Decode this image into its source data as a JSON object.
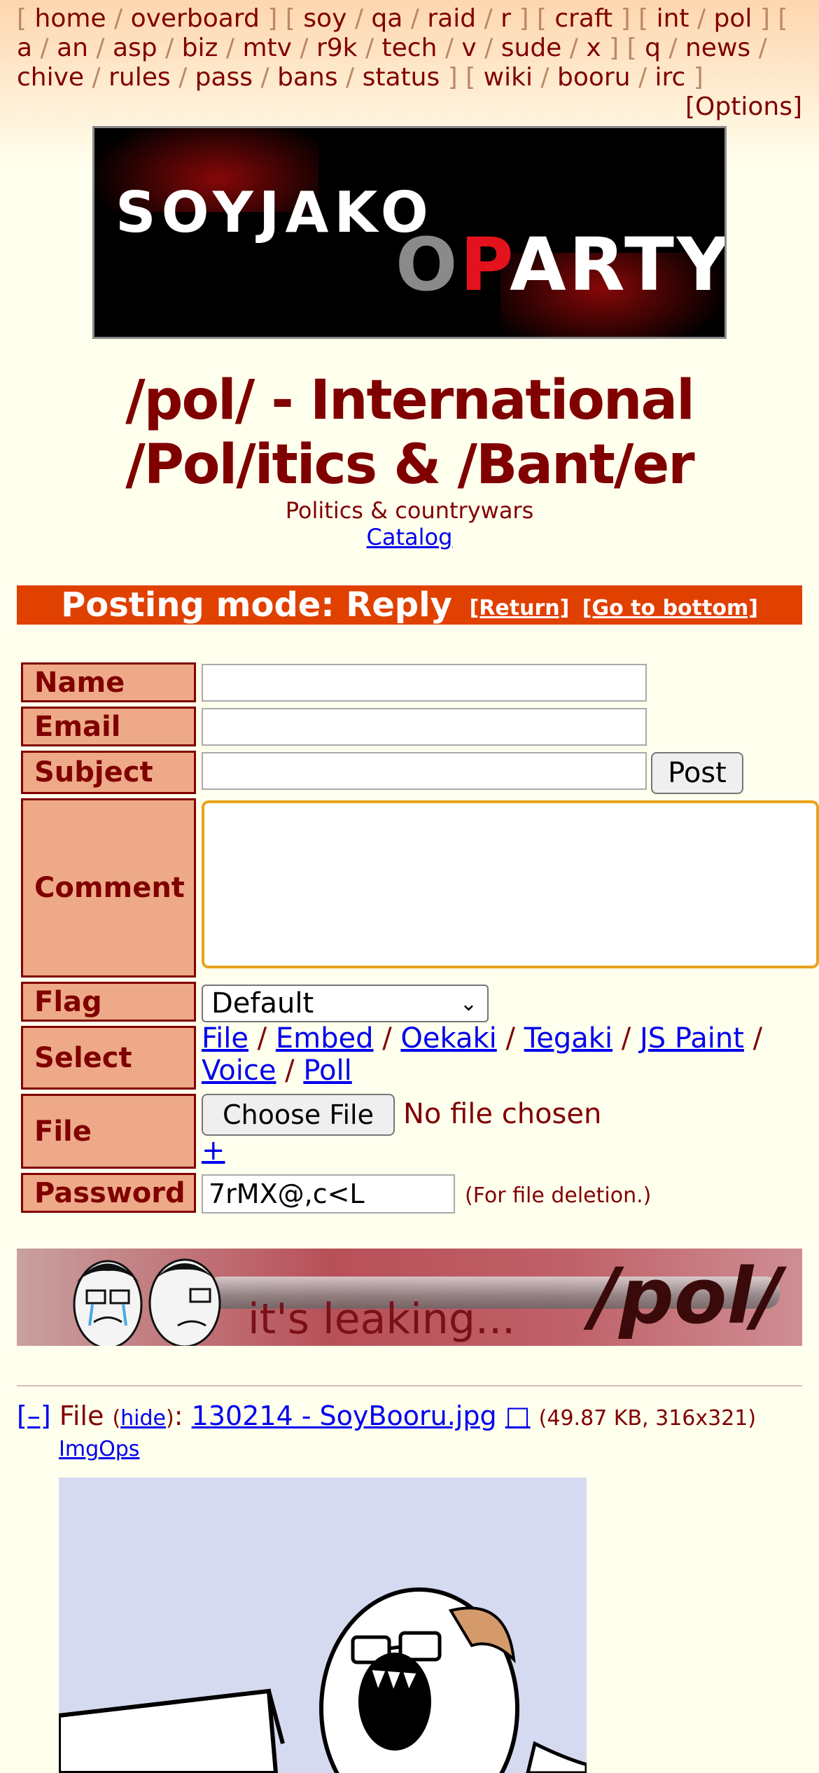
{
  "boardlist": {
    "groups": [
      [
        "home",
        "overboard"
      ],
      [
        "soy",
        "qa",
        "raid",
        "r"
      ],
      [
        "craft"
      ],
      [
        "int",
        "pol"
      ],
      [
        "a",
        "an",
        "asp",
        "biz",
        "mtv",
        "r9k",
        "tech",
        "v",
        "sude",
        "x"
      ],
      [
        "q",
        "news",
        "chive",
        "rules",
        "pass",
        "bans",
        "status"
      ],
      [
        "wiki",
        "booru",
        "irc"
      ]
    ],
    "options": "[Options]"
  },
  "banner": {
    "line1": "SOYJAKO",
    "line2_o": "O",
    "line2_p": "P",
    "line2_rest": "ARTY"
  },
  "board": {
    "title": "/pol/ - International /Pol/itics & /Bant/er",
    "subtitle": "Politics & countrywars",
    "catalog": "Catalog"
  },
  "posting_mode": {
    "text": "Posting mode: Reply",
    "return": "[Return]",
    "bottom": "[Go to bottom]"
  },
  "form": {
    "name_label": "Name",
    "email_label": "Email",
    "subject_label": "Subject",
    "post_button": "Post",
    "comment_label": "Comment",
    "flag_label": "Flag",
    "flag_value": "Default",
    "select_label": "Select",
    "select_options": [
      "File",
      "Embed",
      "Oekaki",
      "Tegaki",
      "JS Paint",
      "Voice",
      "Poll"
    ],
    "file_label": "File",
    "choose_file": "Choose File",
    "no_file": "No file chosen",
    "add_file": "+",
    "password_label": "Password",
    "password_value": "7rMX@,c<L",
    "password_note": "(For file deletion.)"
  },
  "banner2": {
    "caption": "it's leaking...",
    "board": "/pol/"
  },
  "post": {
    "collapse": "[–]",
    "file_word": "File",
    "hide": "hide",
    "filename": "130214 - SoyBooru.jpg",
    "ext_icon": "□",
    "meta": "(49.87 KB, 316x321)",
    "imgops": "ImgOps"
  },
  "colors": {
    "accent": "#800000",
    "posting_bar": "#e04000",
    "label_bg": "#eeaa88",
    "link": "#0000ee",
    "focus": "#e8a317"
  }
}
